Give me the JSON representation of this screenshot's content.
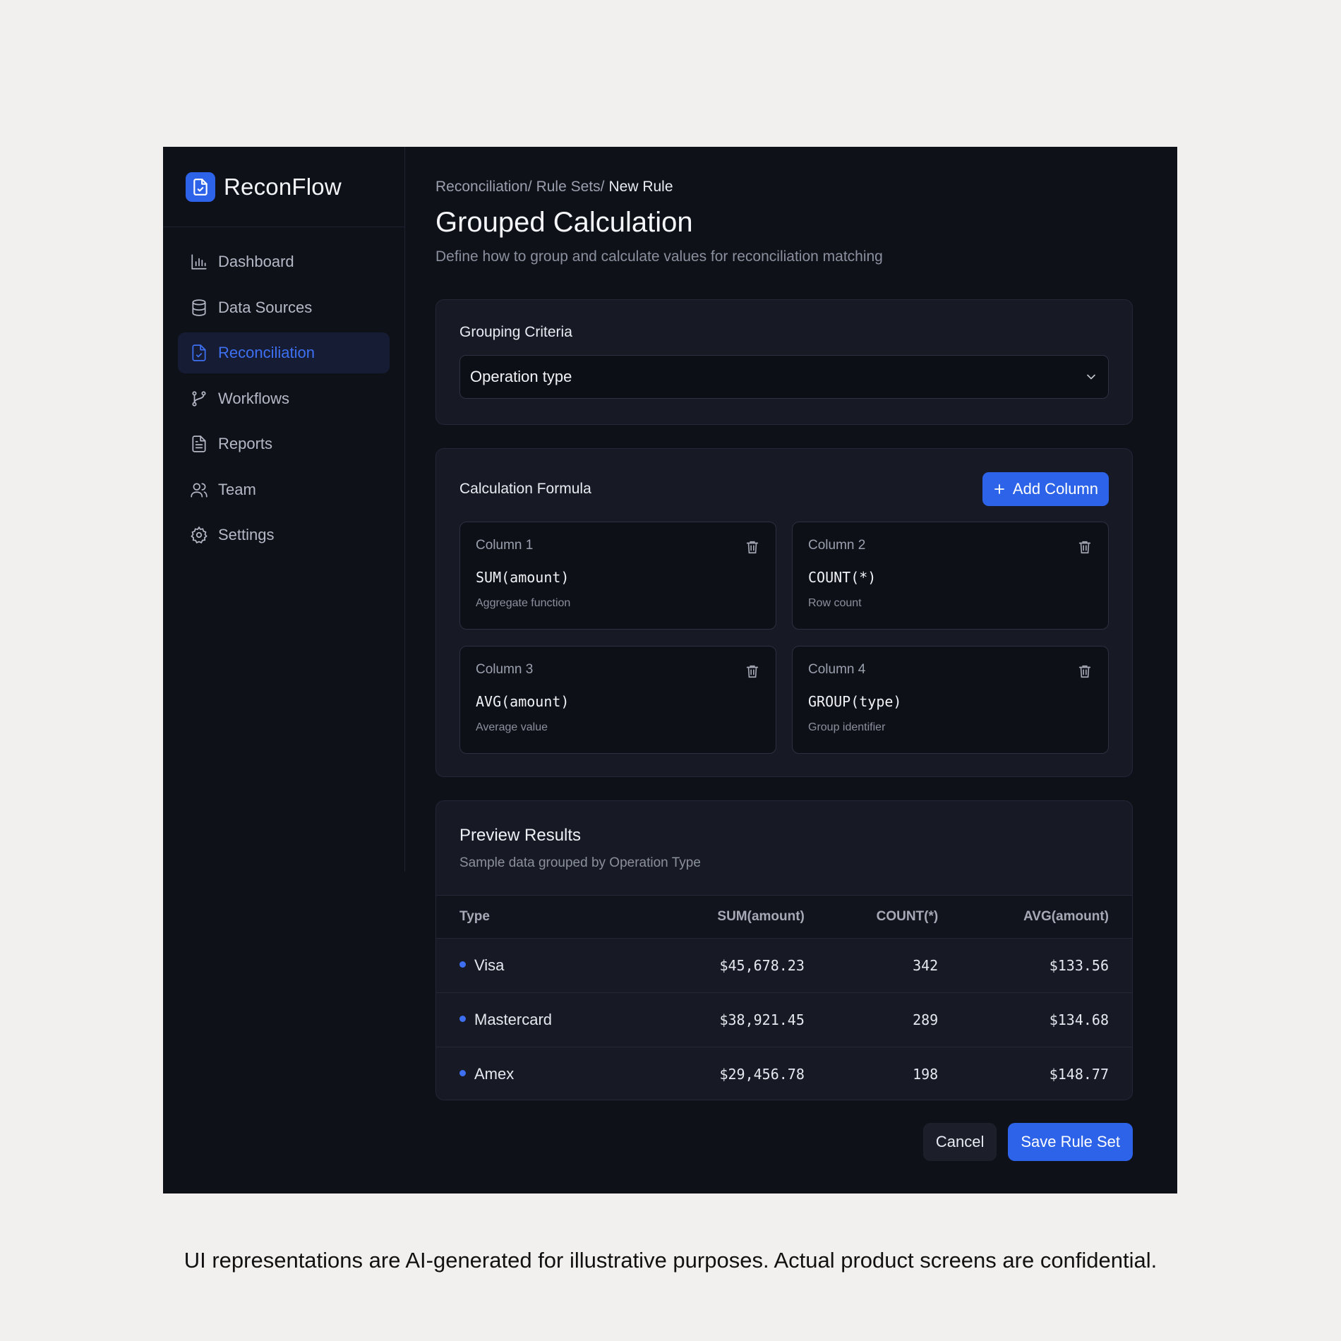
{
  "app": {
    "name": "ReconFlow"
  },
  "sidebar": {
    "items": [
      {
        "label": "Dashboard",
        "icon": "bar-chart-icon",
        "active": false
      },
      {
        "label": "Data Sources",
        "icon": "database-icon",
        "active": false
      },
      {
        "label": "Reconciliation",
        "icon": "file-check-icon",
        "active": true
      },
      {
        "label": "Workflows",
        "icon": "git-branch-icon",
        "active": false
      },
      {
        "label": "Reports",
        "icon": "document-icon",
        "active": false
      },
      {
        "label": "Team",
        "icon": "users-icon",
        "active": false
      },
      {
        "label": "Settings",
        "icon": "gear-icon",
        "active": false
      }
    ]
  },
  "breadcrumb": {
    "items": [
      "Reconciliation/",
      "Rule Sets/"
    ],
    "current": "New Rule"
  },
  "page": {
    "title": "Grouped Calculation",
    "subtitle": "Define how to group and calculate values for reconciliation matching"
  },
  "grouping": {
    "label": "Grouping Criteria",
    "selected": "Operation type"
  },
  "formula": {
    "label": "Calculation Formula",
    "add_label": "Add Column",
    "columns": [
      {
        "name": "Column 1",
        "formula": "SUM(amount)",
        "desc": "Aggregate function"
      },
      {
        "name": "Column 2",
        "formula": "COUNT(*)",
        "desc": "Row count"
      },
      {
        "name": "Column 3",
        "formula": "AVG(amount)",
        "desc": "Average value"
      },
      {
        "name": "Column 4",
        "formula": "GROUP(type)",
        "desc": "Group identifier"
      }
    ]
  },
  "preview": {
    "title": "Preview Results",
    "subtitle": "Sample data grouped by Operation Type",
    "headers": [
      "Type",
      "SUM(amount)",
      "COUNT(*)",
      "AVG(amount)"
    ],
    "rows": [
      [
        "Visa",
        "$45,678.23",
        "342",
        "$133.56"
      ],
      [
        "Mastercard",
        "$38,921.45",
        "289",
        "$134.68"
      ],
      [
        "Amex",
        "$29,456.78",
        "198",
        "$148.77"
      ]
    ]
  },
  "actions": {
    "cancel": "Cancel",
    "save": "Save Rule Set"
  },
  "disclaimer": "UI representations are AI-generated for illustrative purposes. Actual product screens are confidential.",
  "colors": {
    "accent": "#2d63e8",
    "background": "#0f1119",
    "card": "#171a25"
  }
}
